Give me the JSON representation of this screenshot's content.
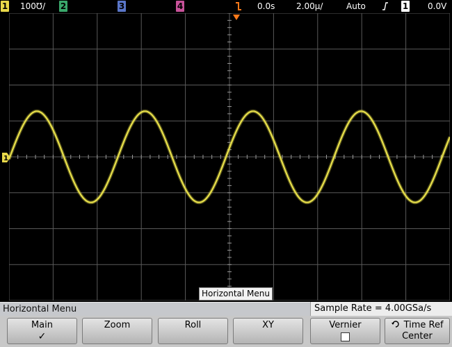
{
  "topbar": {
    "ch1": {
      "num": "1",
      "scale": "100℧/"
    },
    "ch2": {
      "num": "2"
    },
    "ch3": {
      "num": "3"
    },
    "ch4": {
      "num": "4"
    },
    "time_delay": "0.0s",
    "time_scale": "2.00µ/",
    "trigger_mode": "Auto",
    "trigger_slope_symbol": "ʃ",
    "trigger_source": "1",
    "trigger_level": "0.0V"
  },
  "colors": {
    "trace": "#e8e04a",
    "grid": "#5a5a5a",
    "ch1": "#e8d84a",
    "ch2": "#3aa86b",
    "ch3": "#5a76c8",
    "ch4": "#c8529a",
    "trigger_marker": "#ff7a1a"
  },
  "waveform": {
    "channel_marker": "1",
    "cycles_visible": 4
  },
  "popup": {
    "label": "Horizontal Menu"
  },
  "menu": {
    "title": "Horizontal Menu",
    "sample_rate": "Sample Rate = 4.00GSa/s",
    "softkeys": {
      "main": {
        "label": "Main",
        "sub": "✓"
      },
      "zoom": {
        "label": "Zoom"
      },
      "roll": {
        "label": "Roll"
      },
      "xy": {
        "label": "XY"
      },
      "vernier": {
        "label": "Vernier"
      },
      "time_ref": {
        "label": "Time Ref",
        "sub": "Center",
        "icon": "rotate-knob-icon"
      }
    }
  }
}
